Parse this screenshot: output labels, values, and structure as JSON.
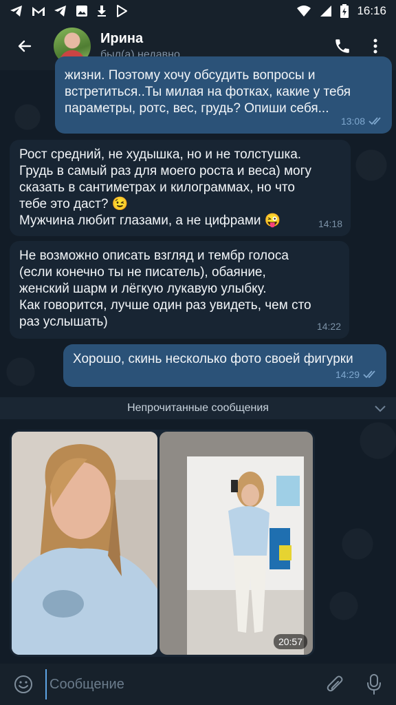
{
  "status_bar": {
    "time": "16:16",
    "left_icons": [
      "telegram-icon",
      "gmail-icon",
      "telegram-icon",
      "image-icon",
      "download-icon",
      "play-store-icon"
    ],
    "right_icons": [
      "wifi-icon",
      "signal-icon",
      "battery-icon"
    ]
  },
  "header": {
    "name": "Ирина",
    "status": "был(а) недавно"
  },
  "messages": [
    {
      "direction": "out",
      "text": "жизни. Поэтому хочу обсудить вопросы и\nвстретиться..Ты милая на фотках, какие у тебя\nпараметры, ротс, вес, грудь? Опиши себя...",
      "time": "13:08",
      "read": true
    },
    {
      "direction": "in",
      "text": "Рост средний, не худышка, но и не толстушка.\nГрудь в самый раз для моего роста и веса) могу\nсказать в сантиметрах и килограммах, но что\nтебе это даст? 😉\nМужчина любит глазами, а не цифрами 😜",
      "time": "14:18"
    },
    {
      "direction": "in",
      "text": "Не возможно описать взгляд и тембр голоса\n(если конечно ты не писатель), обаяние,\nженский шарм и лёгкую лукавую улыбку.\nКак говорится, лучше один раз увидеть, чем сто\nраз услышать)",
      "time": "14:22"
    },
    {
      "direction": "out",
      "text": "Хорошо, скинь несколько фото своей фигурки",
      "time": "14:29",
      "read": true
    }
  ],
  "unread_divider": "Непрочитанные сообщения",
  "album": {
    "photos": [
      "selfie-photo",
      "mirror-selfie-video"
    ],
    "video_duration": "20:57"
  },
  "composer": {
    "placeholder": "Сообщение"
  },
  "colors": {
    "background": "#0e1621",
    "header": "#17212b",
    "outgoing_bubble": "#2b5278",
    "incoming_bubble": "#182533",
    "accent": "#5ea5e6"
  }
}
